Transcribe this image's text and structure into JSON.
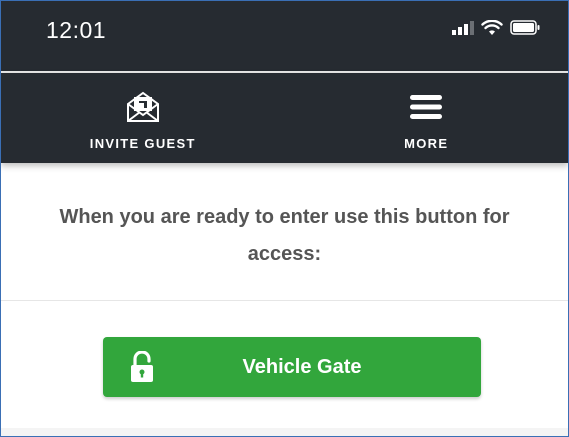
{
  "status_bar": {
    "time": "12:01",
    "icons": [
      "signal-icon",
      "wifi-icon",
      "battery-icon"
    ]
  },
  "nav": {
    "items": [
      {
        "label": "INVITE GUEST",
        "icon": "envelope-invite-icon"
      },
      {
        "label": "MORE",
        "icon": "hamburger-menu-icon"
      }
    ]
  },
  "main": {
    "instruction": "When you are ready to enter use this button for access:",
    "gate_button": {
      "label": "Vehicle Gate",
      "icon": "unlocked-padlock-icon",
      "color": "#32a63c"
    }
  },
  "colors": {
    "header_bg": "#262b31",
    "text_gray": "#555555"
  }
}
